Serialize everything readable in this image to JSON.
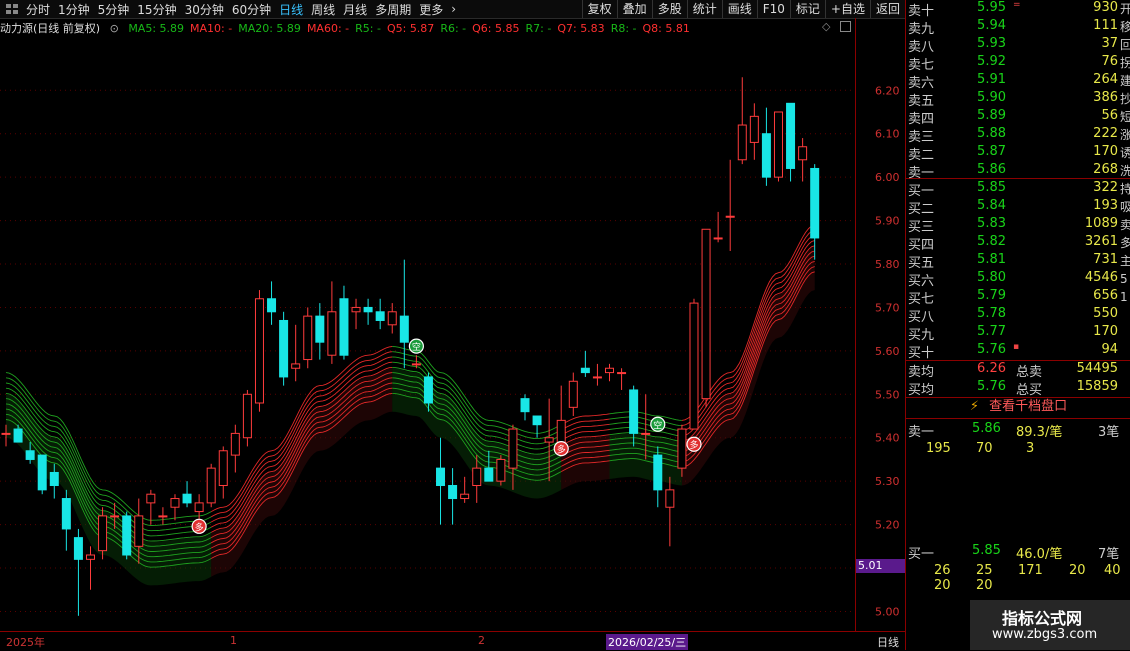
{
  "toolbar": {
    "periods": [
      "分时",
      "1分钟",
      "5分钟",
      "15分钟",
      "30分钟",
      "60分钟",
      "日线",
      "周线",
      "月线",
      "多周期",
      "更多"
    ],
    "active_period": "日线",
    "right_buttons": [
      "复权",
      "叠加",
      "多股",
      "统计",
      "画线",
      "F10",
      "标记",
      "+自选",
      "返回"
    ]
  },
  "indicator_line": {
    "title": "动力源(日线 前复权)",
    "items": [
      {
        "text": "MA5: 5.89",
        "color": "#18b818"
      },
      {
        "text": "MA10: -",
        "color": "#ff3030"
      },
      {
        "text": "MA20: 5.89",
        "color": "#18b818"
      },
      {
        "text": "MA60: -",
        "color": "#ff3030"
      },
      {
        "text": "R5: -",
        "color": "#18b818"
      },
      {
        "text": "Q5: 5.87",
        "color": "#ff3030"
      },
      {
        "text": "R6: -",
        "color": "#18b818"
      },
      {
        "text": "Q6: 5.85",
        "color": "#ff3030"
      },
      {
        "text": "R7: -",
        "color": "#18b818"
      },
      {
        "text": "Q7: 5.83",
        "color": "#ff3030"
      },
      {
        "text": "R8: -",
        "color": "#18b818"
      },
      {
        "text": "Q8: 5.81",
        "color": "#ff3030"
      }
    ]
  },
  "price_axis": {
    "ticks": [
      "6.20",
      "6.10",
      "6.00",
      "5.90",
      "5.80",
      "5.70",
      "5.60",
      "5.50",
      "5.40",
      "5.30",
      "5.20",
      "5.10",
      "5.00"
    ],
    "current_price_tag": "5.01"
  },
  "bottom_axis": {
    "labels": [
      "2025年",
      "1",
      "2"
    ],
    "cursor_date": "2026/02/25/三",
    "period_label": "日线"
  },
  "chart_data": {
    "type": "candlestick",
    "ylim": [
      4.955,
      6.325
    ],
    "up_color": "#ff3c3c",
    "down_color": "#19e6e6",
    "candles": [
      {
        "o": 5.41,
        "h": 5.43,
        "l": 5.38,
        "c": 5.41
      },
      {
        "o": 5.42,
        "h": 5.43,
        "l": 5.39,
        "c": 5.39
      },
      {
        "o": 5.37,
        "h": 5.39,
        "l": 5.34,
        "c": 5.35
      },
      {
        "o": 5.36,
        "h": 5.36,
        "l": 5.27,
        "c": 5.28
      },
      {
        "o": 5.32,
        "h": 5.34,
        "l": 5.26,
        "c": 5.29
      },
      {
        "o": 5.26,
        "h": 5.28,
        "l": 5.14,
        "c": 5.19
      },
      {
        "o": 5.17,
        "h": 5.19,
        "l": 4.99,
        "c": 5.12
      },
      {
        "o": 5.12,
        "h": 5.15,
        "l": 5.05,
        "c": 5.13
      },
      {
        "o": 5.14,
        "h": 5.24,
        "l": 5.12,
        "c": 5.22
      },
      {
        "o": 5.22,
        "h": 5.25,
        "l": 5.19,
        "c": 5.22
      },
      {
        "o": 5.22,
        "h": 5.23,
        "l": 5.12,
        "c": 5.13
      },
      {
        "o": 5.15,
        "h": 5.26,
        "l": 5.11,
        "c": 5.22
      },
      {
        "o": 5.25,
        "h": 5.28,
        "l": 5.2,
        "c": 5.27
      },
      {
        "o": 5.22,
        "h": 5.24,
        "l": 5.2,
        "c": 5.22
      },
      {
        "o": 5.24,
        "h": 5.27,
        "l": 5.21,
        "c": 5.26
      },
      {
        "o": 5.27,
        "h": 5.3,
        "l": 5.24,
        "c": 5.25
      },
      {
        "o": 5.23,
        "h": 5.27,
        "l": 5.2,
        "c": 5.25
      },
      {
        "o": 5.25,
        "h": 5.34,
        "l": 5.24,
        "c": 5.33
      },
      {
        "o": 5.29,
        "h": 5.38,
        "l": 5.26,
        "c": 5.37
      },
      {
        "o": 5.36,
        "h": 5.43,
        "l": 5.32,
        "c": 5.41
      },
      {
        "o": 5.4,
        "h": 5.51,
        "l": 5.38,
        "c": 5.5
      },
      {
        "o": 5.48,
        "h": 5.74,
        "l": 5.46,
        "c": 5.72
      },
      {
        "o": 5.72,
        "h": 5.76,
        "l": 5.66,
        "c": 5.69
      },
      {
        "o": 5.67,
        "h": 5.69,
        "l": 5.52,
        "c": 5.54
      },
      {
        "o": 5.56,
        "h": 5.66,
        "l": 5.53,
        "c": 5.57
      },
      {
        "o": 5.58,
        "h": 5.7,
        "l": 5.56,
        "c": 5.68
      },
      {
        "o": 5.68,
        "h": 5.71,
        "l": 5.58,
        "c": 5.62
      },
      {
        "o": 5.59,
        "h": 5.76,
        "l": 5.57,
        "c": 5.69
      },
      {
        "o": 5.72,
        "h": 5.75,
        "l": 5.58,
        "c": 5.59
      },
      {
        "o": 5.69,
        "h": 5.72,
        "l": 5.65,
        "c": 5.7
      },
      {
        "o": 5.7,
        "h": 5.72,
        "l": 5.66,
        "c": 5.69
      },
      {
        "o": 5.69,
        "h": 5.72,
        "l": 5.65,
        "c": 5.67
      },
      {
        "o": 5.66,
        "h": 5.71,
        "l": 5.64,
        "c": 5.69
      },
      {
        "o": 5.68,
        "h": 5.81,
        "l": 5.56,
        "c": 5.62
      },
      {
        "o": 5.57,
        "h": 5.59,
        "l": 5.56,
        "c": 5.57
      },
      {
        "o": 5.54,
        "h": 5.55,
        "l": 5.46,
        "c": 5.48
      },
      {
        "o": 5.33,
        "h": 5.4,
        "l": 5.2,
        "c": 5.29
      },
      {
        "o": 5.29,
        "h": 5.33,
        "l": 5.2,
        "c": 5.26
      },
      {
        "o": 5.26,
        "h": 5.31,
        "l": 5.25,
        "c": 5.27
      },
      {
        "o": 5.29,
        "h": 5.36,
        "l": 5.25,
        "c": 5.33
      },
      {
        "o": 5.33,
        "h": 5.37,
        "l": 5.3,
        "c": 5.3
      },
      {
        "o": 5.3,
        "h": 5.36,
        "l": 5.29,
        "c": 5.35
      },
      {
        "o": 5.33,
        "h": 5.43,
        "l": 5.28,
        "c": 5.42
      },
      {
        "o": 5.49,
        "h": 5.5,
        "l": 5.44,
        "c": 5.46
      },
      {
        "o": 5.45,
        "h": 5.45,
        "l": 5.4,
        "c": 5.43
      },
      {
        "o": 5.39,
        "h": 5.49,
        "l": 5.3,
        "c": 5.4
      },
      {
        "o": 5.37,
        "h": 5.52,
        "l": 5.36,
        "c": 5.44
      },
      {
        "o": 5.47,
        "h": 5.55,
        "l": 5.45,
        "c": 5.53
      },
      {
        "o": 5.56,
        "h": 5.6,
        "l": 5.54,
        "c": 5.55
      },
      {
        "o": 5.54,
        "h": 5.57,
        "l": 5.52,
        "c": 5.54
      },
      {
        "o": 5.55,
        "h": 5.57,
        "l": 5.53,
        "c": 5.56
      },
      {
        "o": 5.55,
        "h": 5.56,
        "l": 5.51,
        "c": 5.55
      },
      {
        "o": 5.51,
        "h": 5.52,
        "l": 5.38,
        "c": 5.41
      },
      {
        "o": 5.41,
        "h": 5.5,
        "l": 5.35,
        "c": 5.41
      },
      {
        "o": 5.36,
        "h": 5.38,
        "l": 5.24,
        "c": 5.28
      },
      {
        "o": 5.24,
        "h": 5.31,
        "l": 5.15,
        "c": 5.28
      },
      {
        "o": 5.33,
        "h": 5.43,
        "l": 5.31,
        "c": 5.42
      },
      {
        "o": 5.42,
        "h": 5.72,
        "l": 5.42,
        "c": 5.71
      },
      {
        "o": 5.49,
        "h": 5.88,
        "l": 5.47,
        "c": 5.88
      },
      {
        "o": 5.86,
        "h": 5.92,
        "l": 5.85,
        "c": 5.86
      },
      {
        "o": 5.91,
        "h": 6.04,
        "l": 5.83,
        "c": 5.91
      },
      {
        "o": 6.04,
        "h": 6.23,
        "l": 6.03,
        "c": 6.12
      },
      {
        "o": 6.08,
        "h": 6.17,
        "l": 6.04,
        "c": 6.14
      },
      {
        "o": 6.1,
        "h": 6.16,
        "l": 5.98,
        "c": 6.0
      },
      {
        "o": 6.0,
        "h": 6.15,
        "l": 5.99,
        "c": 6.15
      },
      {
        "o": 6.17,
        "h": 6.17,
        "l": 5.99,
        "c": 6.02
      },
      {
        "o": 6.04,
        "h": 6.09,
        "l": 5.99,
        "c": 6.07
      },
      {
        "o": 6.02,
        "h": 6.03,
        "l": 5.81,
        "c": 5.86
      }
    ],
    "ribbon": {
      "x_index": [
        0,
        4,
        8,
        12,
        16,
        18,
        22,
        26,
        30,
        32,
        34,
        36,
        40,
        44,
        48,
        52,
        54,
        56,
        60,
        64,
        67
      ],
      "base": [
        5.55,
        5.45,
        5.28,
        5.21,
        5.22,
        5.24,
        5.37,
        5.52,
        5.59,
        5.61,
        5.6,
        5.55,
        5.44,
        5.41,
        5.45,
        5.46,
        5.45,
        5.44,
        5.55,
        5.78,
        5.89
      ],
      "offsets": [
        0,
        -0.012,
        -0.024,
        -0.036,
        -0.048,
        -0.06,
        -0.072,
        -0.084,
        -0.096,
        -0.108
      ],
      "fill_offsets": [
        -0.05,
        -0.15
      ],
      "red_segments": [
        [
          17,
          32
        ],
        [
          46,
          50
        ],
        [
          56,
          67
        ]
      ],
      "green_segments": [
        [
          0,
          17
        ],
        [
          32,
          46
        ],
        [
          50,
          56
        ]
      ]
    },
    "signals": [
      {
        "type": "buy",
        "text": "多",
        "i": 16,
        "price": 5.196
      },
      {
        "type": "sell",
        "text": "空",
        "i": 34,
        "price": 5.611
      },
      {
        "type": "buy",
        "text": "多",
        "i": 46,
        "price": 5.375
      },
      {
        "type": "sell",
        "text": "空",
        "i": 54,
        "price": 5.431
      },
      {
        "type": "buy",
        "text": "多",
        "i": 57,
        "price": 5.385
      }
    ]
  },
  "orderbook": {
    "asks": [
      {
        "label": "卖十",
        "price": "5.95",
        "vol": "930",
        "mark": "="
      },
      {
        "label": "卖九",
        "price": "5.94",
        "vol": "111",
        "mark": ""
      },
      {
        "label": "卖八",
        "price": "5.93",
        "vol": "37",
        "mark": ""
      },
      {
        "label": "卖七",
        "price": "5.92",
        "vol": "76",
        "mark": ""
      },
      {
        "label": "卖六",
        "price": "5.91",
        "vol": "264",
        "mark": ""
      },
      {
        "label": "卖五",
        "price": "5.90",
        "vol": "386",
        "mark": ""
      },
      {
        "label": "卖四",
        "price": "5.89",
        "vol": "56",
        "mark": ""
      },
      {
        "label": "卖三",
        "price": "5.88",
        "vol": "222",
        "mark": ""
      },
      {
        "label": "卖二",
        "price": "5.87",
        "vol": "170",
        "mark": ""
      },
      {
        "label": "卖一",
        "price": "5.86",
        "vol": "268",
        "mark": ""
      }
    ],
    "bids": [
      {
        "label": "买一",
        "price": "5.85",
        "vol": "322",
        "mark": ""
      },
      {
        "label": "买二",
        "price": "5.84",
        "vol": "193",
        "mark": ""
      },
      {
        "label": "买三",
        "price": "5.83",
        "vol": "1089",
        "mark": ""
      },
      {
        "label": "买四",
        "price": "5.82",
        "vol": "3261",
        "mark": ""
      },
      {
        "label": "买五",
        "price": "5.81",
        "vol": "731",
        "mark": ""
      },
      {
        "label": "买六",
        "price": "5.80",
        "vol": "4546",
        "mark": ""
      },
      {
        "label": "买七",
        "price": "5.79",
        "vol": "656",
        "mark": ""
      },
      {
        "label": "买八",
        "price": "5.78",
        "vol": "550",
        "mark": ""
      },
      {
        "label": "买九",
        "price": "5.77",
        "vol": "170",
        "mark": ""
      },
      {
        "label": "买十",
        "price": "5.76",
        "vol": "94",
        "mark": "▪"
      }
    ],
    "summary": [
      {
        "label": "卖均",
        "price": "6.26",
        "price_color": "#ff4040",
        "label2": "总卖",
        "vol": "54495"
      },
      {
        "label": "买均",
        "price": "5.76",
        "price_color": "#19d419",
        "label2": "总买",
        "vol": "15859"
      }
    ],
    "side_chars": [
      "开",
      "移",
      "回",
      "拐",
      "建",
      "抄",
      "短",
      "涨",
      "诱",
      "洗",
      "持",
      "吸",
      "卖",
      "多",
      "主",
      "5",
      "1"
    ],
    "qian_dang_button": "查看千档盘口",
    "sell_queue": {
      "label": "卖一",
      "price": "5.86",
      "avg": "89.3/笔",
      "count": "3笔",
      "orders": [
        "195",
        "70",
        "3"
      ]
    },
    "buy_queue": {
      "label": "买一",
      "price": "5.85",
      "avg": "46.0/笔",
      "count": "7笔",
      "orders_row1": [
        "26",
        "25",
        "171",
        "20",
        "40"
      ],
      "orders_row2": [
        "20",
        "20"
      ]
    }
  },
  "watermark": {
    "line1": "指标公式网",
    "line2": "www.zbgs3.com"
  }
}
